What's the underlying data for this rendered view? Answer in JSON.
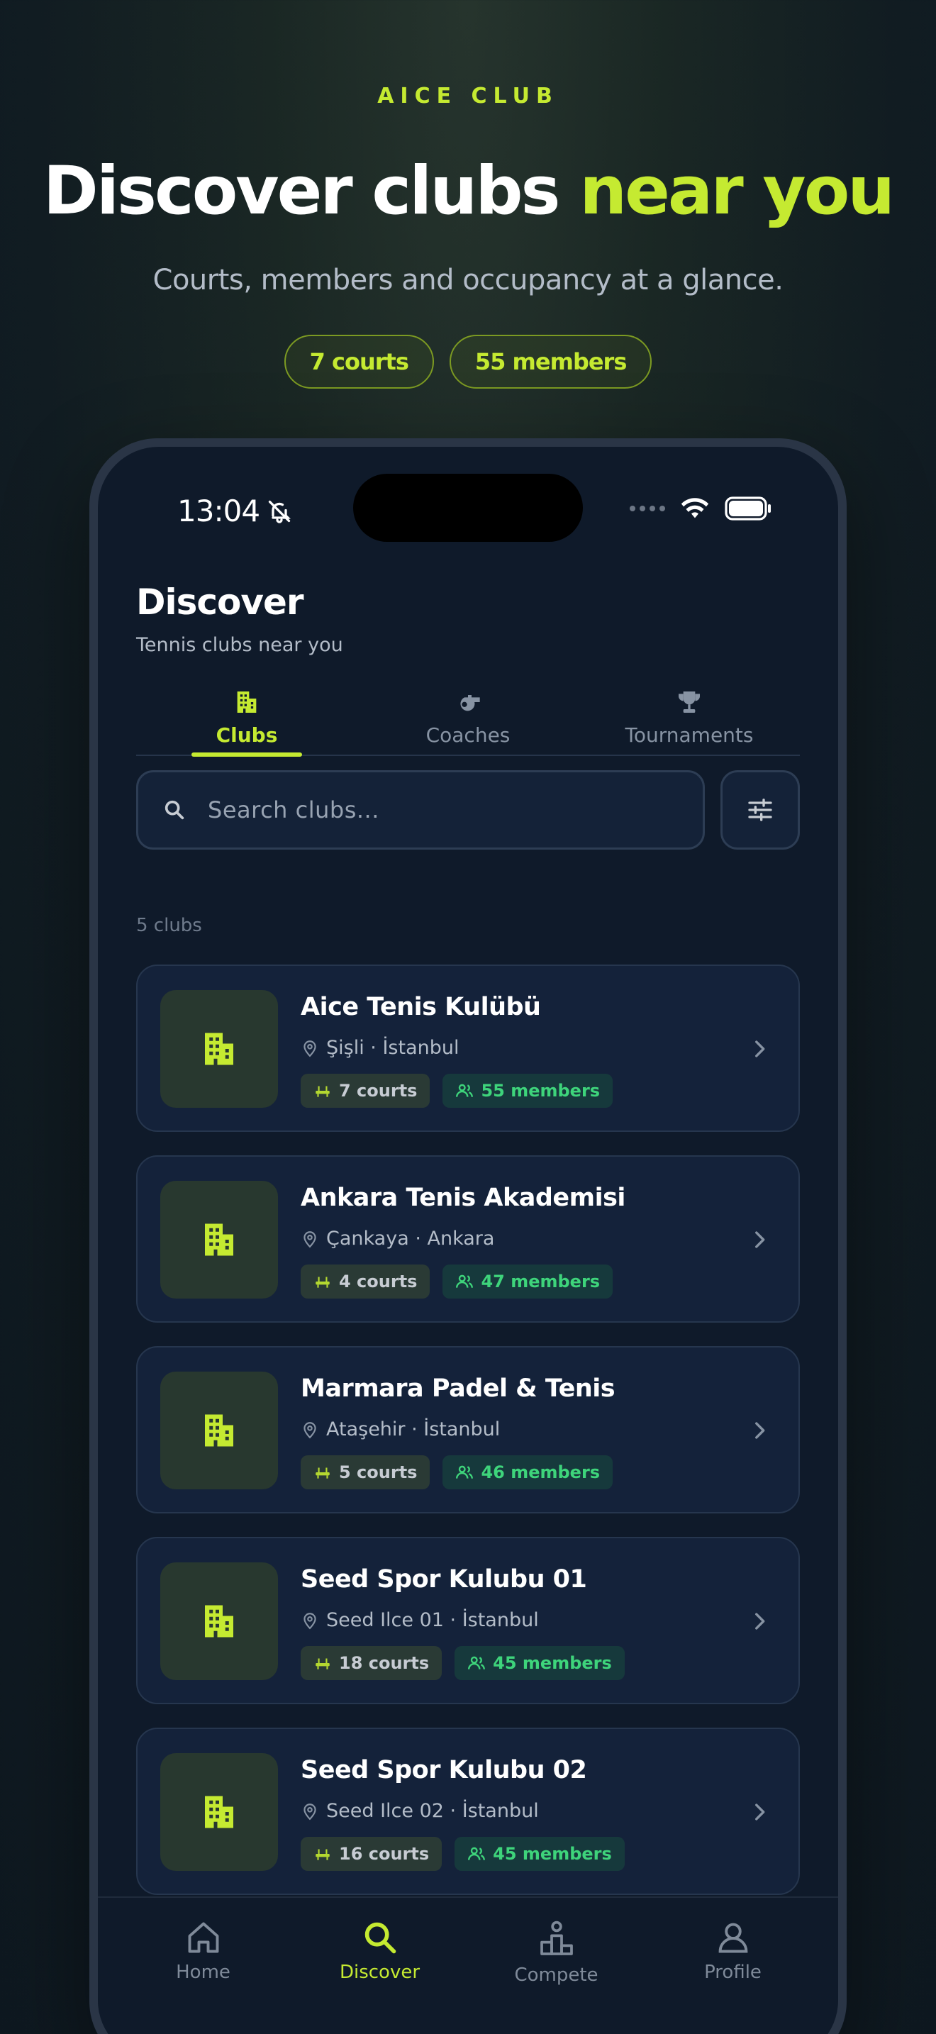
{
  "hero": {
    "eyebrow": "AICE CLUB",
    "title_main": "Discover clubs ",
    "title_accent": "near you",
    "subtitle": "Courts, members and occupancy at a glance.",
    "pills": [
      "7 courts",
      "55 members"
    ]
  },
  "status_bar": {
    "time": "13:04"
  },
  "header": {
    "title": "Discover",
    "subtitle": "Tennis clubs near you"
  },
  "tabs": [
    {
      "label": "Clubs",
      "icon": "building-icon",
      "active": true
    },
    {
      "label": "Coaches",
      "icon": "whistle-icon",
      "active": false
    },
    {
      "label": "Tournaments",
      "icon": "trophy-icon",
      "active": false
    }
  ],
  "search": {
    "placeholder": "Search clubs..."
  },
  "results": {
    "count_label": "5 clubs"
  },
  "clubs": [
    {
      "name": "Aice Tenis Kulübü",
      "location": "Şişli · İstanbul",
      "courts": "7 courts",
      "members": "55 members"
    },
    {
      "name": "Ankara Tenis Akademisi",
      "location": "Çankaya · Ankara",
      "courts": "4 courts",
      "members": "47 members"
    },
    {
      "name": "Marmara Padel & Tenis",
      "location": "Ataşehir · İstanbul",
      "courts": "5 courts",
      "members": "46 members"
    },
    {
      "name": "Seed Spor Kulubu 01",
      "location": "Seed Ilce 01 · İstanbul",
      "courts": "18 courts",
      "members": "45 members"
    },
    {
      "name": "Seed Spor Kulubu 02",
      "location": "Seed Ilce 02 · İstanbul",
      "courts": "16 courts",
      "members": "45 members"
    }
  ],
  "bottom_nav": [
    {
      "label": "Home",
      "icon": "home-icon",
      "active": false
    },
    {
      "label": "Discover",
      "icon": "search-icon",
      "active": true
    },
    {
      "label": "Compete",
      "icon": "podium-icon",
      "active": false
    },
    {
      "label": "Profile",
      "icon": "user-icon",
      "active": false
    }
  ],
  "colors": {
    "accent": "#c5ea31",
    "members": "#3ed47b",
    "background": "#0f1a2a"
  }
}
